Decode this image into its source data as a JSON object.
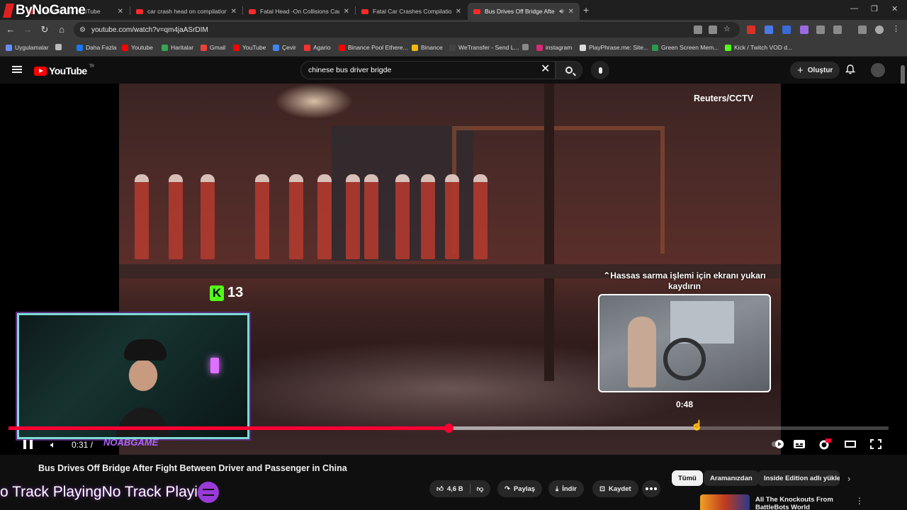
{
  "browser": {
    "brand": "ByNoGame",
    "tabs": [
      {
        "title": "…wahashes - YouTube",
        "active": false
      },
      {
        "title": "car crash head on compilation",
        "active": false
      },
      {
        "title": "Fatal Head -On Collisions Caug",
        "active": false
      },
      {
        "title": "Fatal Car Crashes Compilation",
        "active": false
      },
      {
        "title": "Bus Drives Off Bridge After",
        "active": true
      }
    ],
    "url": "youtube.com/watch?v=qm4jaASrDIM",
    "bookmarks": [
      {
        "label": "Uygulamalar",
        "color": "#6b8cff"
      },
      {
        "label": "Daha Fazla",
        "color": "#1877f2"
      },
      {
        "label": "Youtube",
        "color": "#ff0000"
      },
      {
        "label": "Haritalar",
        "color": "#34a853"
      },
      {
        "label": "Gmail",
        "color": "#ea4335"
      },
      {
        "label": "YouTube",
        "color": "#ff0000"
      },
      {
        "label": "Çevir",
        "color": "#4285f4"
      },
      {
        "label": "Agario",
        "color": "#ff3030"
      },
      {
        "label": "Binance Pool Ethere...",
        "color": "#ff0000"
      },
      {
        "label": "Binance",
        "color": "#f0b90b"
      },
      {
        "label": "WeTransfer - Send L...",
        "color": "#444444"
      },
      {
        "label": "",
        "color": "#888888"
      },
      {
        "label": "instagram",
        "color": "#d62976"
      },
      {
        "label": "PlayPhrase.me: Site...",
        "color": "#dddddd"
      },
      {
        "label": "Green Screen Mem...",
        "color": "#2a9a4a"
      },
      {
        "label": "Kick / Twitch VOD d...",
        "color": "#53fc18"
      }
    ]
  },
  "youtube": {
    "logo_text": "YouTube",
    "country_code": "TR",
    "search_query": "chinese bus driver brigde",
    "create_label": "Oluştur"
  },
  "player": {
    "watermark": "Reuters/CCTV",
    "kick_viewers": "13",
    "scroll_hint": "⌃Hassas sarma işlemi için ekranı yukarı kaydırın",
    "preview_time": "0:48",
    "current_time": "0:31 /",
    "stream_tag": "NOABGAME",
    "progress_played": 0.5,
    "progress_hover": 0.78,
    "colors": {
      "accent": "#ff0033",
      "kick": "#53fc18"
    }
  },
  "video": {
    "title": "Bus Drives Off Bridge After Fight Between Driver and Passenger in China",
    "like_count": "4,6 B",
    "share_label": "Paylaş",
    "download_label": "İndir",
    "save_label": "Kaydet"
  },
  "overlay": {
    "spotify_text": "o Track PlayingNo Track Playi"
  },
  "recommendations": {
    "chips": [
      "Tümü",
      "Aramanızdan",
      "Inside Edition adlı yükle"
    ],
    "first_title": "All The Knockouts From BattleBots World Championship"
  }
}
